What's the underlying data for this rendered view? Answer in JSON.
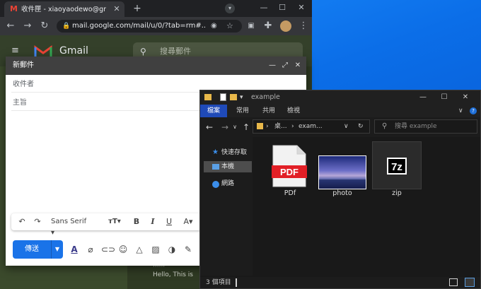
{
  "chrome": {
    "tab_title": "收件匣 - xiaoyaodewo@gmail...",
    "url": "mail.google.com/mail/u/0/?tab=rm#..."
  },
  "gmail": {
    "logo_word": "Gmail",
    "search_placeholder": "搜尋郵件",
    "preview_line1": "······",
    "preview_line2": "Hello, This is"
  },
  "compose": {
    "title": "新郵件",
    "to_placeholder": "收件者",
    "subject_placeholder": "主旨",
    "font_name": "Sans Serif",
    "send_label": "傳送"
  },
  "explorer": {
    "title": "example",
    "ribbon_tabs": [
      "檔案",
      "常用",
      "共用",
      "檢視"
    ],
    "path": [
      "桌...",
      "exam..."
    ],
    "search_placeholder": "搜尋 example",
    "nav_items": [
      "快速存取",
      "本機",
      "網路"
    ],
    "files": [
      {
        "name": "PDf",
        "icon": "pdf-file-icon"
      },
      {
        "name": "photo",
        "icon": "image-file-icon"
      },
      {
        "name": "zip",
        "icon": "7z-archive-icon"
      }
    ],
    "status": "3 個項目"
  },
  "colors": {
    "gmail_bg": "#2f3a23",
    "send_blue": "#1a73e8",
    "explorer_bg": "#191919",
    "ribbon_file": "#1f4ab8"
  }
}
